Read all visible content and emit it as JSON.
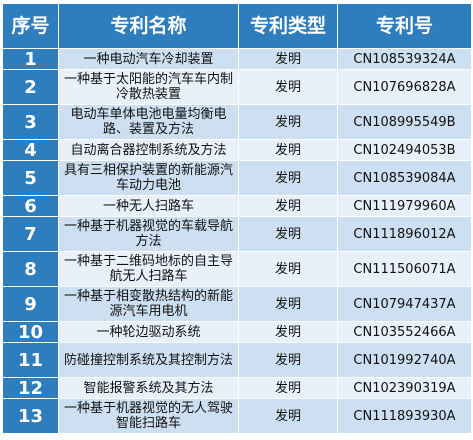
{
  "headers": {
    "index": "序号",
    "name": "专利名称",
    "type": "专利类型",
    "number": "专利号"
  },
  "rows": [
    {
      "index": "1",
      "name": "一种电动汽车冷却装置",
      "type": "发明",
      "number": "CN108539324A"
    },
    {
      "index": "2",
      "name": "一种基于太阳能的汽车车内制冷散热装置",
      "type": "发明",
      "number": "CN107696828A"
    },
    {
      "index": "3",
      "name": "电动车单体电池电量均衡电路、装置及方法",
      "type": "发明",
      "number": "CN108995549B"
    },
    {
      "index": "4",
      "name": "自动离合器控制系统及方法",
      "type": "发明",
      "number": "CN102494053B"
    },
    {
      "index": "5",
      "name": "具有三相保护装置的新能源汽车动力电池",
      "type": "发明",
      "number": "CN108539084A"
    },
    {
      "index": "6",
      "name": "一种无人扫路车",
      "type": "发明",
      "number": "CN111979960A"
    },
    {
      "index": "7",
      "name": "一种基于机器视觉的车载导航方法",
      "type": "发明",
      "number": "CN111896012A"
    },
    {
      "index": "8",
      "name": "一种基于二维码地标的自主导航无人扫路车",
      "type": "发明",
      "number": "CN111506071A"
    },
    {
      "index": "9",
      "name": "一种基于相变散热结构的新能源汽车用电机",
      "type": "发明",
      "number": "CN107947437A"
    },
    {
      "index": "10",
      "name": "一种轮边驱动系统",
      "type": "发明",
      "number": "CN103552466A"
    },
    {
      "index": "11",
      "name": "防碰撞控制系统及其控制方法",
      "type": "发明",
      "number": "CN101992740A"
    },
    {
      "index": "12",
      "name": "智能报警系统及其方法",
      "type": "发明",
      "number": "CN102390319A"
    },
    {
      "index": "13",
      "name": "一种基于机器视觉的无人驾驶智能扫路车",
      "type": "发明",
      "number": "CN111893930A"
    }
  ]
}
